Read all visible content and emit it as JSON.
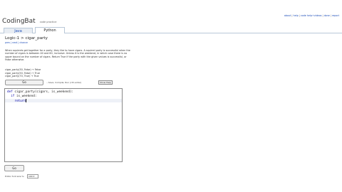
{
  "brand": {
    "name": "CodingBat",
    "tagline": "code practice"
  },
  "top_links": [
    "about",
    "help",
    "code help+videos",
    "done",
    "report"
  ],
  "tabs": [
    {
      "label": "Java"
    },
    {
      "label": "Python"
    }
  ],
  "problem": {
    "title": "Logic-1 > cigar_party",
    "breadcrumbs": [
      "prev",
      "next",
      "chance"
    ],
    "description": "When squirrels get together for a party, they like to have cigars. A squirrel party is successful when the number of cigars is between 40 and 60, inclusive. Unless it is the weekend, in which case there is no upper bound on the number of cigars. Return True if the party with the given values is successful, or False otherwise.",
    "examples": [
      "cigar_party(30, False) → False",
      "cigar_party(50, False) → True",
      "cigar_party(70, True) → True"
    ]
  },
  "actions": {
    "go_label": "Go",
    "go_hint": "...Save, Compile, Run (ctrl-enter)",
    "show_help_label": "Show Help"
  },
  "code": {
    "line1_kw": "def ",
    "line1_rest": "cigar_party(cigars, is_weekend):",
    "line2_kw": "if ",
    "line2_rest": "is_weekend:",
    "line3_kw": "return"
  },
  "editor_settings": {
    "font_size_label": "Editor font size %:",
    "font_size_value": "100"
  }
}
